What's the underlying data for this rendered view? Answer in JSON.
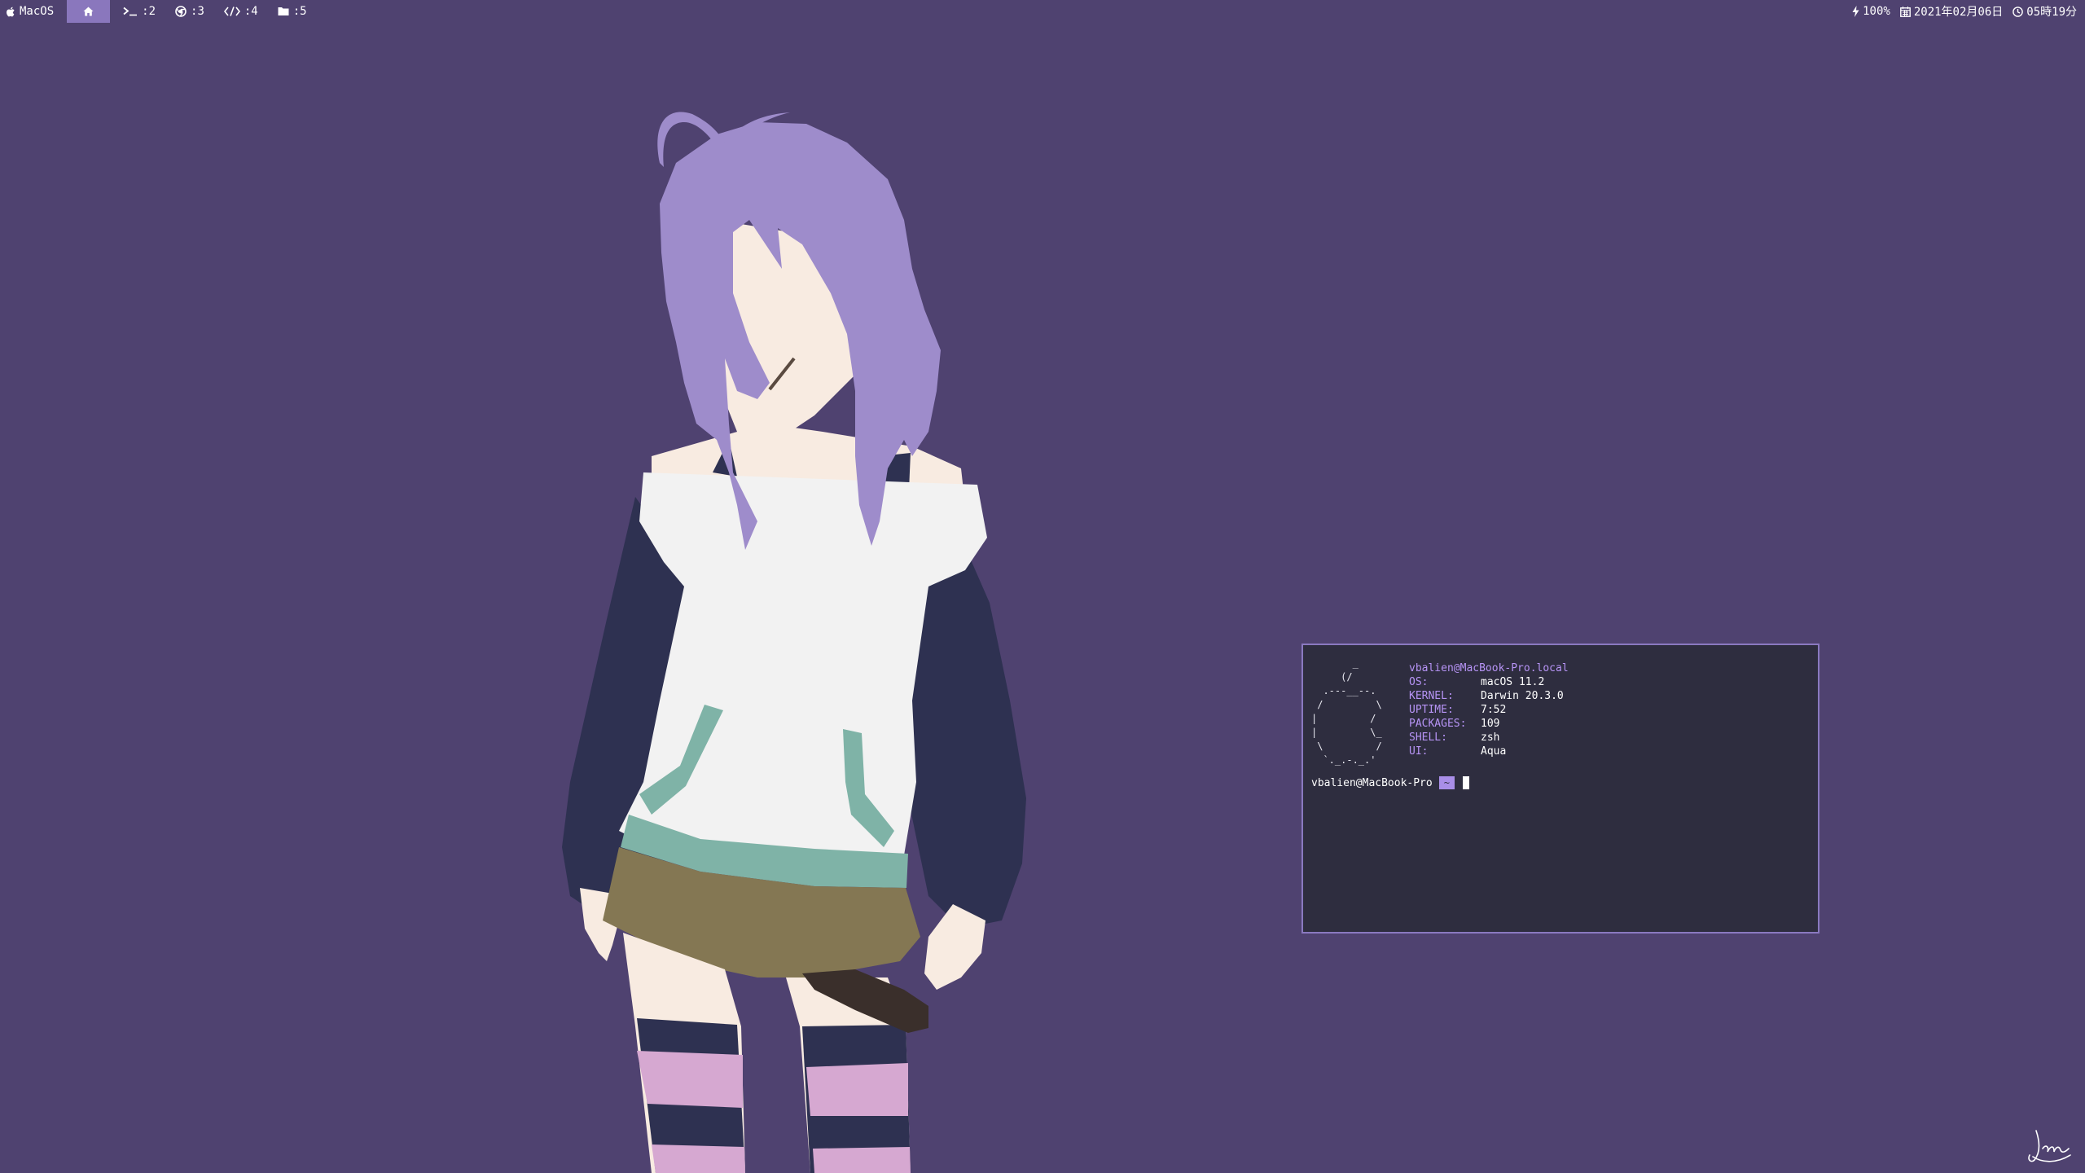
{
  "topbar": {
    "apple_label": "MacOS",
    "workspaces": [
      {
        "label": "",
        "icon": "home-icon",
        "active": true
      },
      {
        "label": ":2",
        "icon": "terminal-icon",
        "active": false
      },
      {
        "label": ":3",
        "icon": "chrome-icon",
        "active": false
      },
      {
        "label": ":4",
        "icon": "code-icon",
        "active": false
      },
      {
        "label": ":5",
        "icon": "folder-icon",
        "active": false
      }
    ],
    "battery": "100%",
    "date": "2021年02月06日",
    "time": "05時19分",
    "accent_color": "#8a77bd"
  },
  "terminal": {
    "ascii_logo": "       _\n     (/\n  .---__--.\n /         \\\n|         /\n|         \\_\n \\         /\n  `._.-._.'",
    "user_host": "vbalien@MacBook-Pro.local",
    "info": [
      {
        "key": "OS:",
        "value": "macOS 11.2"
      },
      {
        "key": "KERNEL:",
        "value": "Darwin 20.3.0"
      },
      {
        "key": "UPTIME:",
        "value": "7:52"
      },
      {
        "key": "PACKAGES:",
        "value": "109"
      },
      {
        "key": "SHELL:",
        "value": "zsh"
      },
      {
        "key": "UI:",
        "value": "Aqua"
      }
    ],
    "prompt_host": "vbalien@MacBook-Pro",
    "prompt_dir": "~",
    "accent_color": "#b794f6"
  },
  "desktop": {
    "background_color": "#4f4270",
    "wallpaper": "minimalist-anime-girl-illustration"
  }
}
